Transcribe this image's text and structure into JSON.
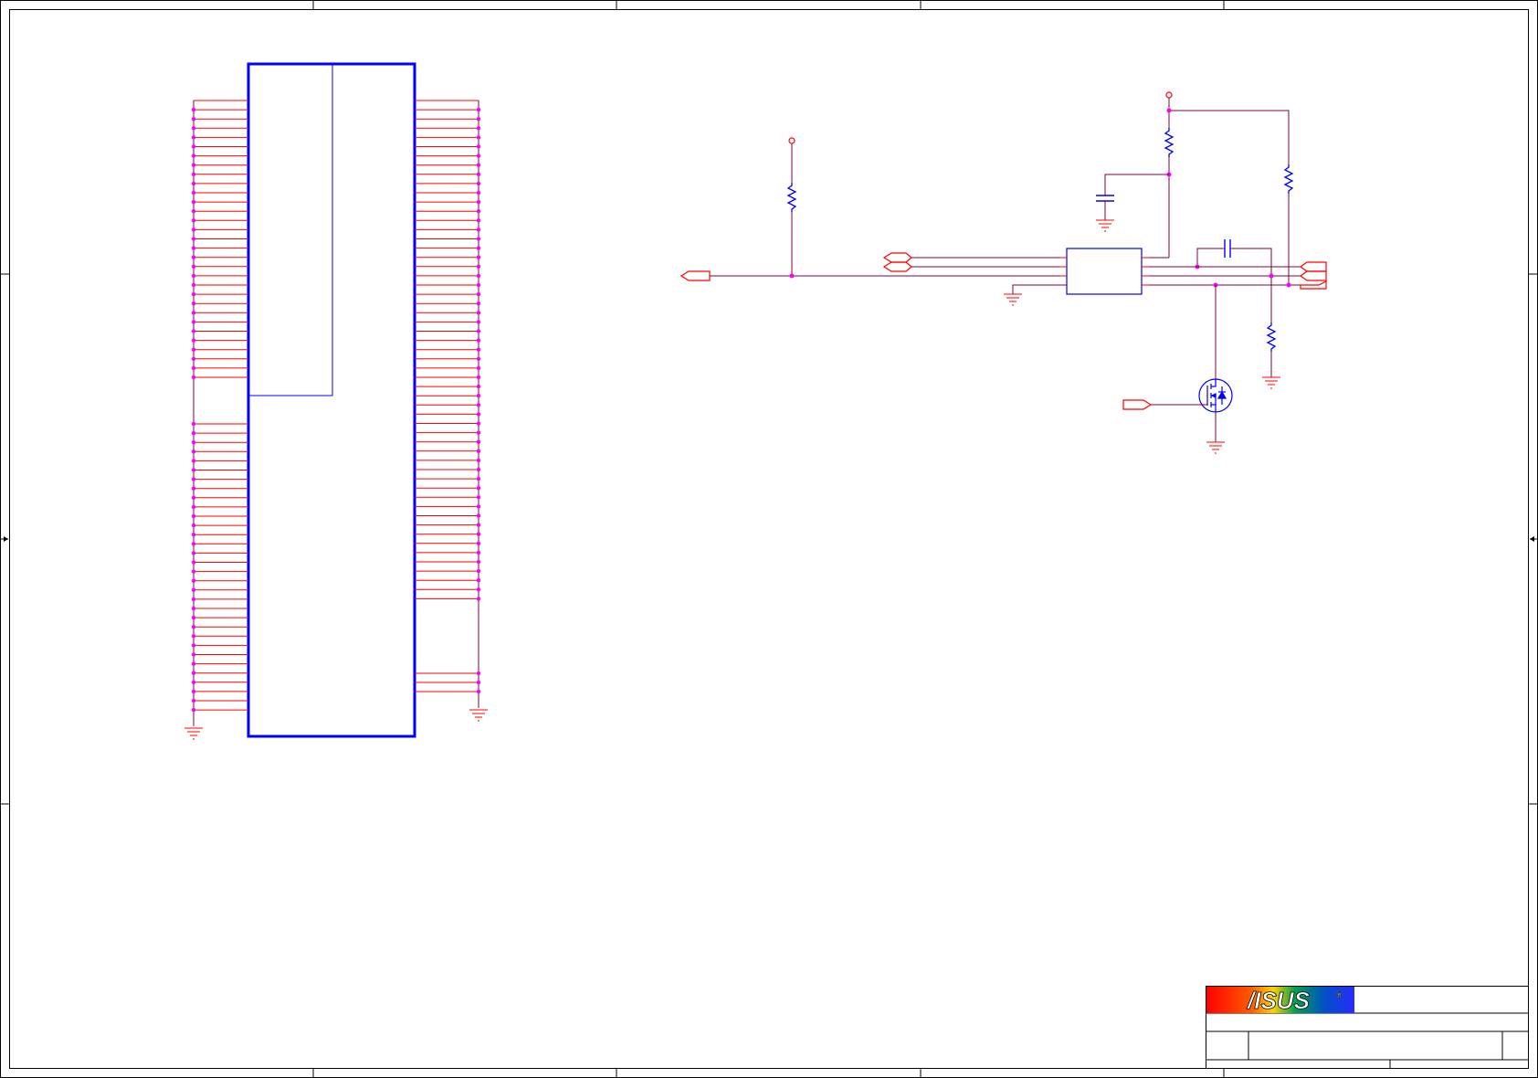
{
  "document": {
    "type": "schematic"
  },
  "title_block": {
    "logo_text": "/ISUS",
    "registered_mark": "®",
    "logo_colors": [
      "#ff0000",
      "#ff8800",
      "#ffd200",
      "#00a050",
      "#0050c8",
      "#2a2aff"
    ]
  },
  "colors": {
    "border": "#000000",
    "component": "#0000ff",
    "pin_wire": "#ff0000",
    "net_wire": "#800040",
    "junction": "#ff00ff",
    "power_symbol": "#ff0000",
    "ground_symbol": "#ff0000"
  },
  "connector": {
    "left_pin_count": 66,
    "right_pin_count": 57,
    "right_gnd_pins": 3
  },
  "circuit": {
    "resistors": 4,
    "capacitors": 2,
    "ic_count": 1,
    "mosfet_count": 1,
    "off_page_connectors": 6,
    "power_ports": 2,
    "ground_symbols": 6
  }
}
